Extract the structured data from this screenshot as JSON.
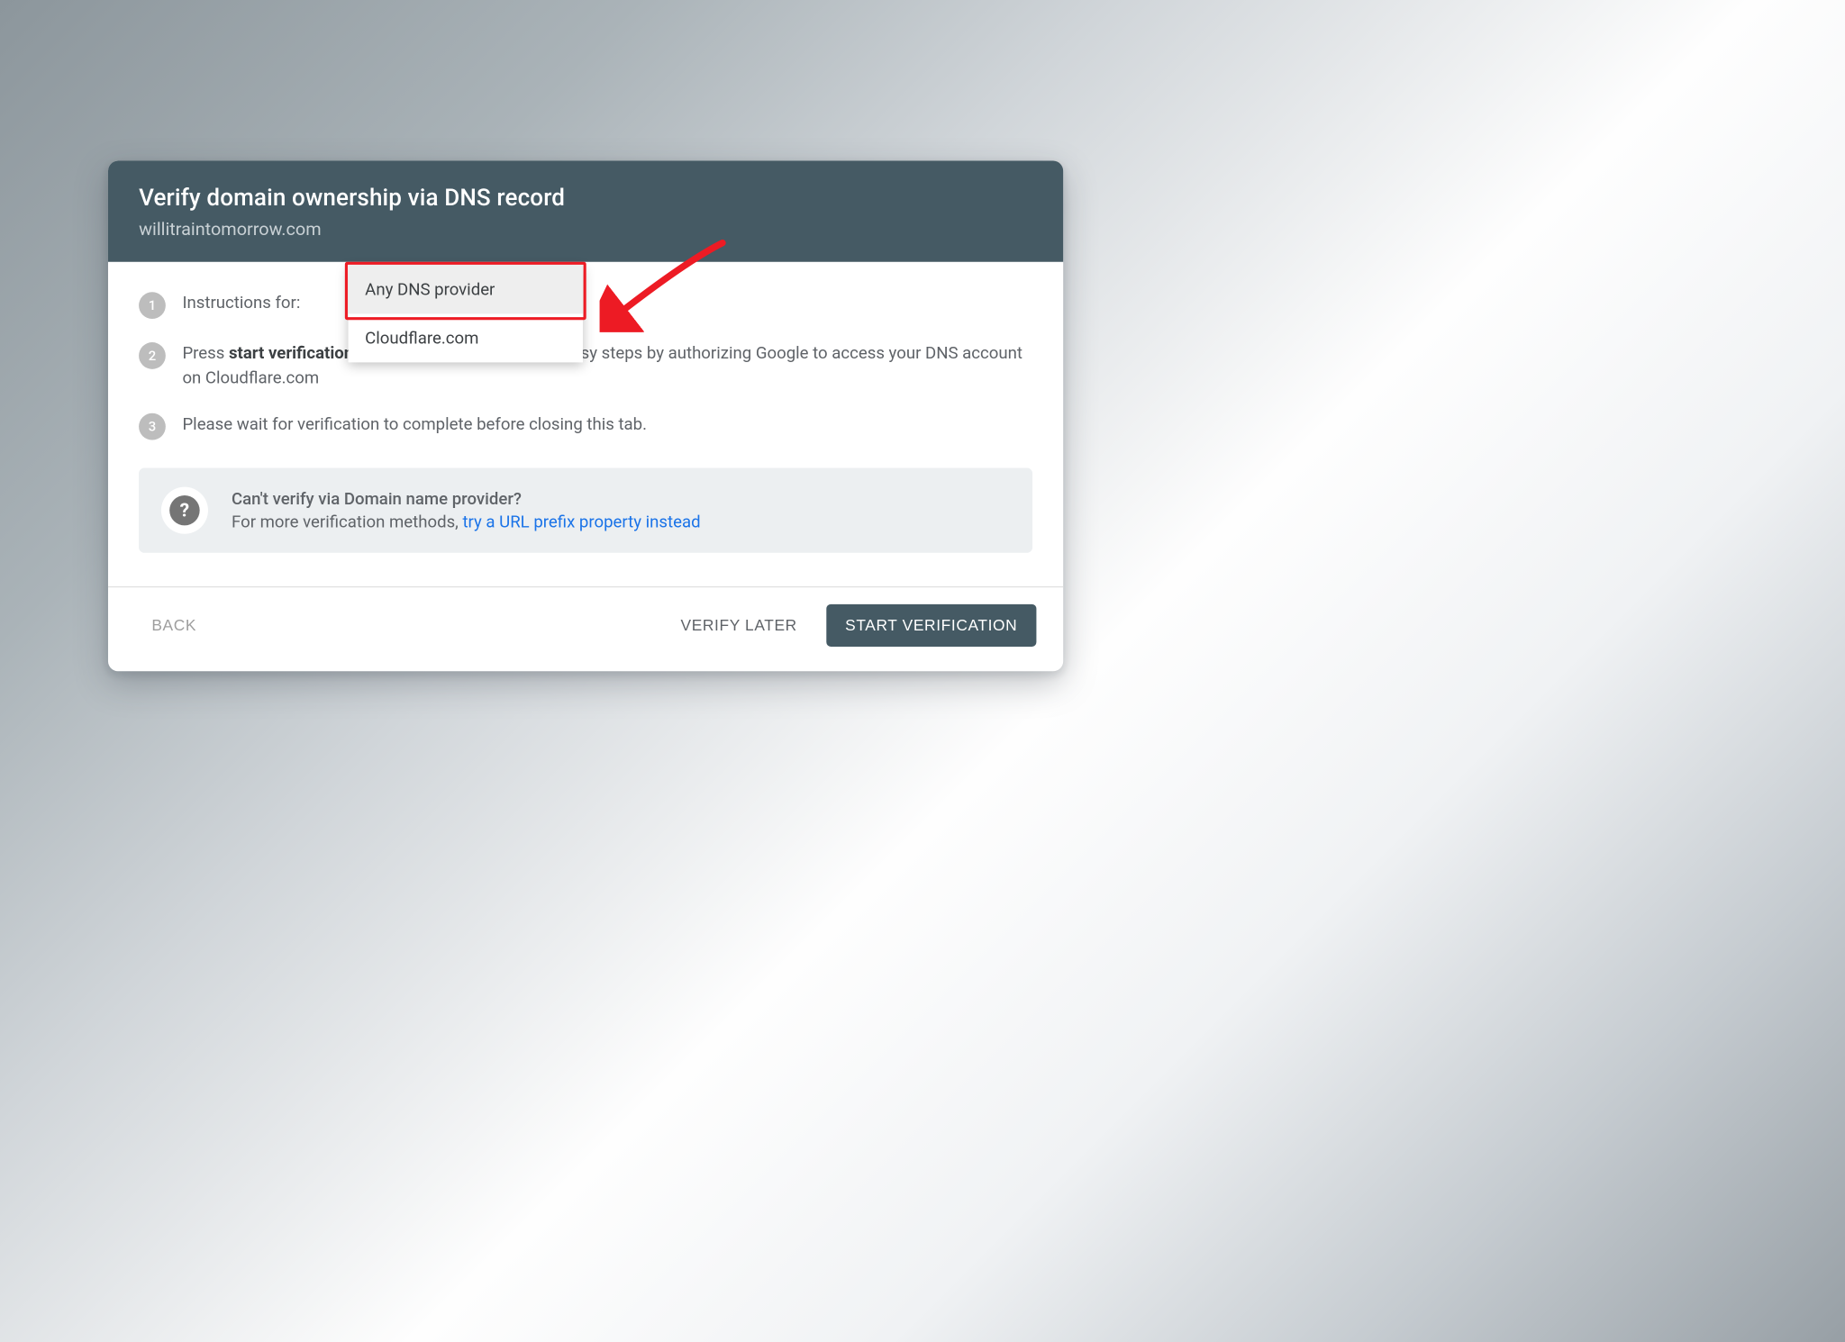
{
  "header": {
    "title": "Verify domain ownership via DNS record",
    "subtitle": "willitraintomorrow.com"
  },
  "steps": {
    "s1": {
      "num": "1",
      "prefix": "Instructions for:"
    },
    "s2": {
      "num": "2",
      "prefix": "Press ",
      "bold": "start verification",
      "rest": " below and verify with a few easy steps by authorizing Google to access your DNS account on Cloudflare.com"
    },
    "s3": {
      "num": "3",
      "text": "Please wait for verification to complete before closing this tab."
    }
  },
  "dropdown": {
    "options": [
      {
        "label": "Any DNS provider",
        "active": true
      },
      {
        "label": "Cloudflare.com",
        "active": false
      }
    ]
  },
  "info": {
    "title": "Can't verify via Domain name provider?",
    "lead": "For more verification methods, ",
    "link": "try a URL prefix property instead"
  },
  "footer": {
    "back": "BACK",
    "later": "VERIFY LATER",
    "start": "START VERIFICATION"
  },
  "colors": {
    "accent": "#455a64",
    "highlight": "#ed1b24",
    "link": "#1a73e8"
  }
}
